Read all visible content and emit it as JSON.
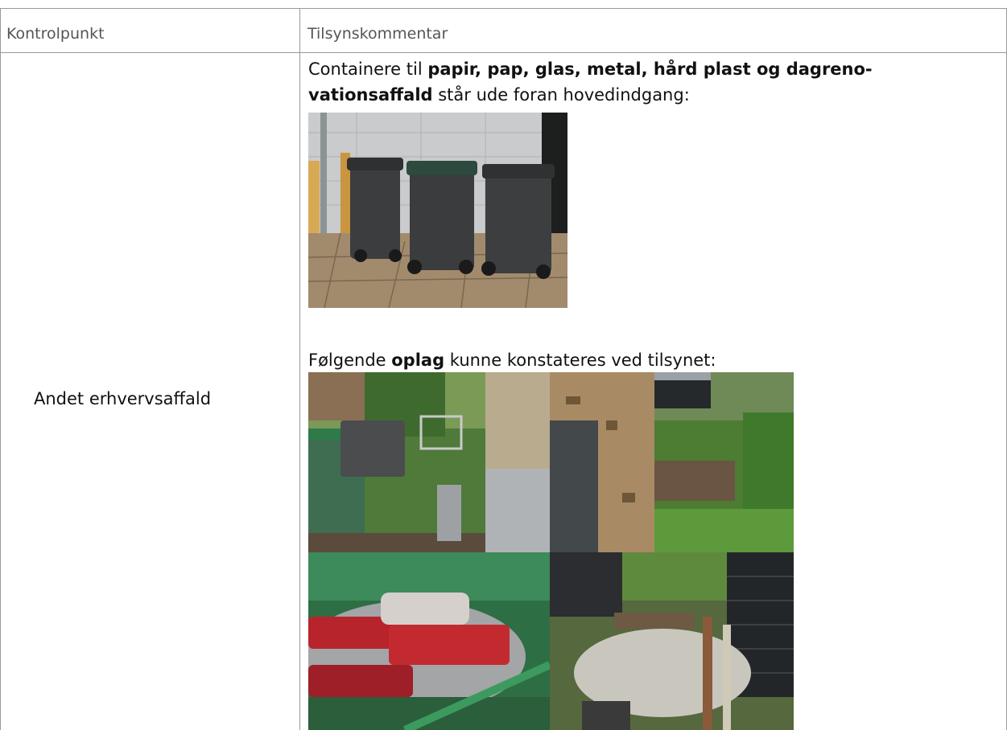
{
  "table": {
    "header": {
      "col1": "Kontrolpunkt",
      "col2": "Tilsynskommentar"
    },
    "row": {
      "label": "Andet erhvervsaffald",
      "para1": {
        "pre": "Containere til ",
        "bold_line1": "papir, pap, glas, metal, hård plast og dagreno-",
        "bold_line2": "vationsaffald",
        "post": " står ude foran hovedindgang:"
      },
      "para2": {
        "pre": "Følgende ",
        "bold": "oplag",
        "post": " kunne konstateres ved tilsynet:"
      }
    }
  },
  "photos": [
    {
      "name": "bins-photo",
      "subject": "three dark grey wheelie bins against a wall"
    },
    {
      "name": "storage-photo-1",
      "subject": "green container and bins in overgrown yard"
    },
    {
      "name": "storage-photo-2",
      "subject": "chipboard panel and pallets in garden"
    },
    {
      "name": "storage-photo-3",
      "subject": "red plastic wrapping inside green container"
    },
    {
      "name": "storage-photo-4",
      "subject": "stacked timber and plastic-wrapped material by black shed"
    }
  ]
}
